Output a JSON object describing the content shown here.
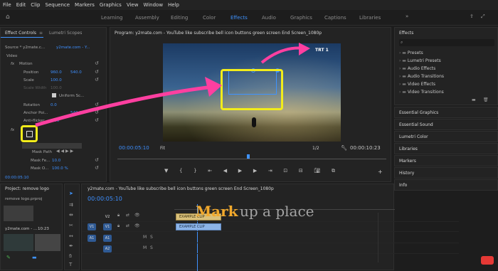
{
  "menu": [
    "File",
    "Edit",
    "Clip",
    "Sequence",
    "Markers",
    "Graphics",
    "View",
    "Window",
    "Help"
  ],
  "workspaces": [
    "Learning",
    "Assembly",
    "Editing",
    "Color",
    "Effects",
    "Audio",
    "Graphics",
    "Captions",
    "Libraries"
  ],
  "workspace_active": "Effects",
  "effect_controls": {
    "tab": "Effect Controls",
    "tab2": "Lumetri Scopes",
    "source": "Source * y2mate.c...",
    "clip": "y2mate.com - Y...",
    "video_label": "Video",
    "motion": "Motion",
    "position_label": "Position",
    "position_x": "960.0",
    "position_y": "540.0",
    "scale_label": "Scale",
    "scale_value": "100.0",
    "scale_width_label": "Scale Width",
    "scale_width_value": "100.0",
    "uniform_scale": "Uniform Sc...",
    "rotation_label": "Rotation",
    "rotation_value": "0.0",
    "anchor_label": "Anchor Poi...",
    "anchor_x": "960.0",
    "anchor_y": "540.0",
    "antiflicker_label": "Anti-flicker...",
    "antiflicker_value": "0.00",
    "mask_path": "Mask Path",
    "mask_feather_label": "Mask Fe...",
    "mask_feather_value": "10.0",
    "mask_opacity_label": "Mask O...",
    "mask_opacity_value": "100.0 %",
    "timecode": "00:00:05:10"
  },
  "program": {
    "title": "Program: y2mate.com - YouTube like subscribe bell icon buttons green screen End Screen_1080p",
    "timecode": "00:00:05:10",
    "fit": "Fit",
    "resolution": "1/2",
    "duration": "00:00:10:23",
    "logo": "TRT 1"
  },
  "effects_panel": {
    "title": "Effects",
    "items": [
      "Presets",
      "Lumetri Presets",
      "Audio Effects",
      "Audio Transitions",
      "Video Effects",
      "Video Transitions"
    ],
    "sections": [
      "Essential Graphics",
      "Essential Sound",
      "Lumetri Color",
      "Libraries",
      "Markers",
      "History",
      "Info"
    ]
  },
  "project": {
    "title": "Project: remove logo",
    "file": "remove logo.prproj",
    "clip_name": "y2mate.com - ...",
    "clip_duration": "10:23"
  },
  "timeline": {
    "title": "y2mate.com - YouTube like subscribe bell icon buttons green screen End Screen_1080p",
    "timecode": "00:00:05:10",
    "tracks": [
      "V2",
      "V1",
      "A1",
      "A2"
    ],
    "clip_label": "EXAMPLE CLIP",
    "clip_label2": "EXAMPLE CLIP",
    "overlay_text_mark": "Mark",
    "overlay_text_rest": "up a place"
  },
  "colors": {
    "accent": "#3f93ff",
    "highlight": "#f2ec1b",
    "arrow": "#ff3fa0"
  }
}
